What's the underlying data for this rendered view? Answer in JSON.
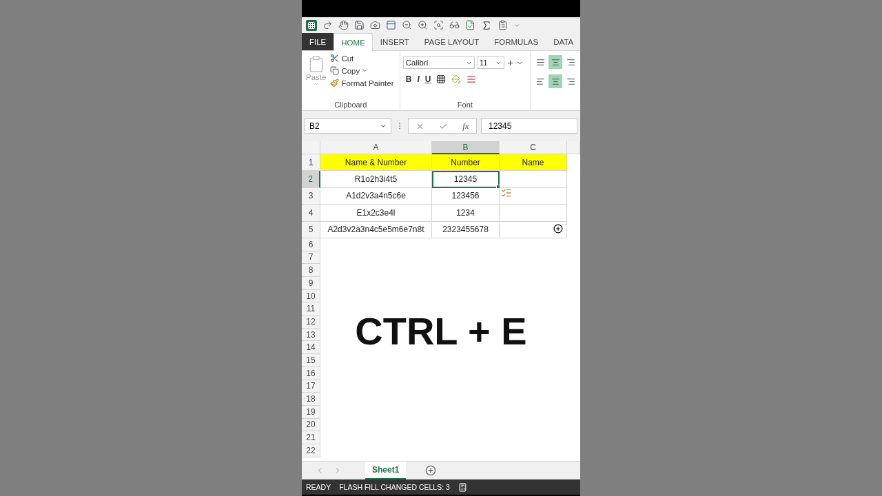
{
  "ribbon_tabs": [
    {
      "label": "FILE",
      "kind": "file",
      "selected": false
    },
    {
      "label": "HOME",
      "kind": "tab",
      "selected": true
    },
    {
      "label": "INSERT",
      "kind": "tab",
      "selected": false
    },
    {
      "label": "PAGE LAYOUT",
      "kind": "tab",
      "selected": false
    },
    {
      "label": "FORMULAS",
      "kind": "tab",
      "selected": false
    },
    {
      "label": "DATA",
      "kind": "tab",
      "selected": false
    }
  ],
  "clipboard": {
    "title": "Clipboard",
    "paste": "Paste",
    "cut": "Cut",
    "copy": "Copy",
    "format_painter": "Format Painter"
  },
  "font": {
    "title": "Font",
    "name": "Calibri",
    "size": "11",
    "bold": "B",
    "italic": "I",
    "underline": "U"
  },
  "alignment": [
    {
      "selected": false
    },
    {
      "selected": true
    },
    {
      "selected": false
    },
    {
      "selected": false
    },
    {
      "selected": true
    },
    {
      "selected": false
    }
  ],
  "formula_bar": {
    "name_box": "B2",
    "function_label": "fx",
    "value": "12345"
  },
  "sheet": {
    "columns": [
      {
        "label": "A",
        "selected": false
      },
      {
        "label": "B",
        "selected": true
      },
      {
        "label": "C",
        "selected": false
      }
    ],
    "rows": [
      {
        "number": "1",
        "selected": false,
        "highlighted": true,
        "cells": [
          {
            "value": "Name & Number",
            "selected": false
          },
          {
            "value": "Number",
            "selected": false
          },
          {
            "value": "Name",
            "selected": false
          }
        ]
      },
      {
        "number": "2",
        "selected": true,
        "highlighted": false,
        "cells": [
          {
            "value": "R1o2h3i4t5",
            "selected": false
          },
          {
            "value": "12345",
            "selected": true
          },
          {
            "selected": false
          }
        ]
      },
      {
        "number": "3",
        "selected": false,
        "highlighted": false,
        "cells": [
          {
            "value": "A1d2v3a4n5c6e",
            "selected": false
          },
          {
            "value": "123456",
            "selected": false
          },
          {
            "selected": false
          }
        ]
      },
      {
        "number": "4",
        "selected": false,
        "highlighted": false,
        "cells": [
          {
            "value": "E1x2c3e4l",
            "selected": false
          },
          {
            "value": "1234",
            "selected": false
          },
          {
            "selected": false
          }
        ]
      },
      {
        "number": "5",
        "selected": false,
        "highlighted": false,
        "cells": [
          {
            "value": "A2d3v2a3n4c5e5m6e7n8t",
            "selected": false
          },
          {
            "value": "2323455678",
            "selected": false
          },
          {
            "selected": false
          }
        ]
      }
    ],
    "empty_rows": [
      "6",
      "7",
      "8",
      "9",
      "10",
      "11",
      "12",
      "13",
      "14",
      "15",
      "16",
      "17",
      "18",
      "19",
      "20",
      "21",
      "22"
    ]
  },
  "caption": "CTRL + E",
  "sheet_tabs": [
    {
      "label": "Sheet1",
      "selected": true
    }
  ],
  "status_bar": [
    "READY",
    "FLASH FILL CHANGED CELLS: 3"
  ]
}
